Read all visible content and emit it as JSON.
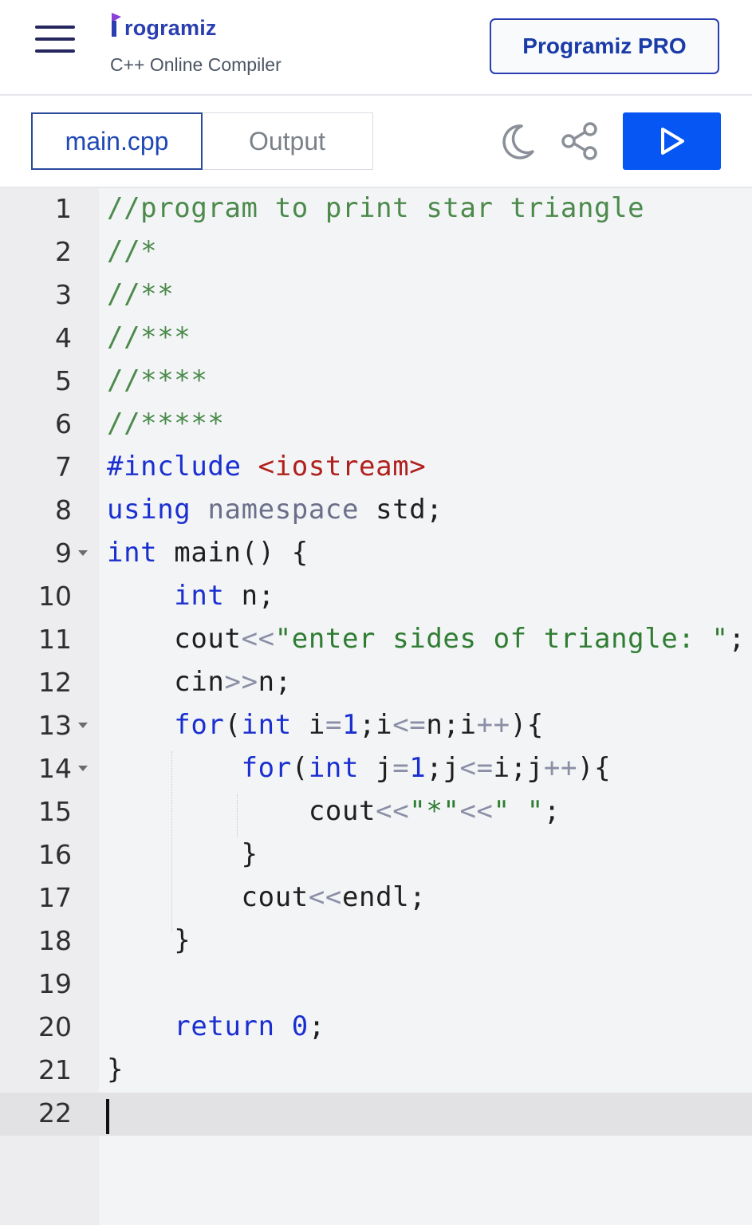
{
  "header": {
    "brand": "rogramiz",
    "subtitle": "C++ Online Compiler",
    "pro_button": "Programiz PRO"
  },
  "tabs": {
    "file": "main.cpp",
    "output": "Output"
  },
  "icons": {
    "menu": "hamburger-menu-icon",
    "theme": "moon-icon",
    "share": "share-icon",
    "run": "play-icon"
  },
  "colors": {
    "brand": "#2a3eb1",
    "run_button": "#0556f3",
    "keyword": "#1a2fd0",
    "comment": "#4b8a4b",
    "string": "#2f7d32",
    "header_include": "#b0201d"
  },
  "editor": {
    "active_line": 22,
    "lines": [
      {
        "num": "1",
        "tokens": [
          [
            "cmt",
            "//program to print star triangle"
          ]
        ]
      },
      {
        "num": "2",
        "tokens": [
          [
            "cmt",
            "//*"
          ]
        ]
      },
      {
        "num": "3",
        "tokens": [
          [
            "cmt",
            "//**"
          ]
        ]
      },
      {
        "num": "4",
        "tokens": [
          [
            "cmt",
            "//***"
          ]
        ]
      },
      {
        "num": "5",
        "tokens": [
          [
            "cmt",
            "//****"
          ]
        ]
      },
      {
        "num": "6",
        "tokens": [
          [
            "cmt",
            "//*****"
          ]
        ]
      },
      {
        "num": "7",
        "tokens": [
          [
            "kw",
            "#include"
          ],
          [
            "pl",
            " "
          ],
          [
            "hdr",
            "<iostream>"
          ]
        ]
      },
      {
        "num": "8",
        "tokens": [
          [
            "kw",
            "using"
          ],
          [
            "pl",
            " "
          ],
          [
            "kw2",
            "namespace"
          ],
          [
            "pl",
            " std;"
          ]
        ]
      },
      {
        "num": "9",
        "fold": true,
        "tokens": [
          [
            "kw",
            "int"
          ],
          [
            "pl",
            " main() {"
          ]
        ]
      },
      {
        "num": "10",
        "tokens": [
          [
            "pl",
            "    "
          ],
          [
            "kw",
            "int"
          ],
          [
            "pl",
            " n;"
          ]
        ]
      },
      {
        "num": "11",
        "tokens": [
          [
            "pl",
            "    cout"
          ],
          [
            "op",
            "<<"
          ],
          [
            "str",
            "\"enter sides of triangle: \""
          ],
          [
            "pl",
            ";"
          ]
        ]
      },
      {
        "num": "12",
        "tokens": [
          [
            "pl",
            "    cin"
          ],
          [
            "op",
            ">>"
          ],
          [
            "pl",
            "n;"
          ]
        ]
      },
      {
        "num": "13",
        "fold": true,
        "tokens": [
          [
            "pl",
            "    "
          ],
          [
            "kw",
            "for"
          ],
          [
            "pl",
            "("
          ],
          [
            "kw",
            "int"
          ],
          [
            "pl",
            " i"
          ],
          [
            "op",
            "="
          ],
          [
            "num",
            "1"
          ],
          [
            "pl",
            ";i"
          ],
          [
            "op",
            "<="
          ],
          [
            "pl",
            "n;i"
          ],
          [
            "op",
            "++"
          ],
          [
            "pl",
            "){"
          ]
        ]
      },
      {
        "num": "14",
        "fold": true,
        "tokens": [
          [
            "pl",
            "        "
          ],
          [
            "kw",
            "for"
          ],
          [
            "pl",
            "("
          ],
          [
            "kw",
            "int"
          ],
          [
            "pl",
            " j"
          ],
          [
            "op",
            "="
          ],
          [
            "num",
            "1"
          ],
          [
            "pl",
            ";j"
          ],
          [
            "op",
            "<="
          ],
          [
            "pl",
            "i;j"
          ],
          [
            "op",
            "++"
          ],
          [
            "pl",
            "){"
          ]
        ]
      },
      {
        "num": "15",
        "tokens": [
          [
            "pl",
            "            cout"
          ],
          [
            "op",
            "<<"
          ],
          [
            "str",
            "\"*\""
          ],
          [
            "op",
            "<<"
          ],
          [
            "str",
            "\" \""
          ],
          [
            "pl",
            ";"
          ]
        ]
      },
      {
        "num": "16",
        "tokens": [
          [
            "pl",
            "        }"
          ]
        ]
      },
      {
        "num": "17",
        "tokens": [
          [
            "pl",
            "        cout"
          ],
          [
            "op",
            "<<"
          ],
          [
            "pl",
            "endl;"
          ]
        ]
      },
      {
        "num": "18",
        "tokens": [
          [
            "pl",
            "    }"
          ]
        ]
      },
      {
        "num": "19",
        "tokens": []
      },
      {
        "num": "20",
        "tokens": [
          [
            "pl",
            "    "
          ],
          [
            "kw",
            "return"
          ],
          [
            "pl",
            " "
          ],
          [
            "num",
            "0"
          ],
          [
            "pl",
            ";"
          ]
        ]
      },
      {
        "num": "21",
        "tokens": [
          [
            "pl",
            "}"
          ]
        ]
      },
      {
        "num": "22",
        "tokens": []
      }
    ]
  }
}
